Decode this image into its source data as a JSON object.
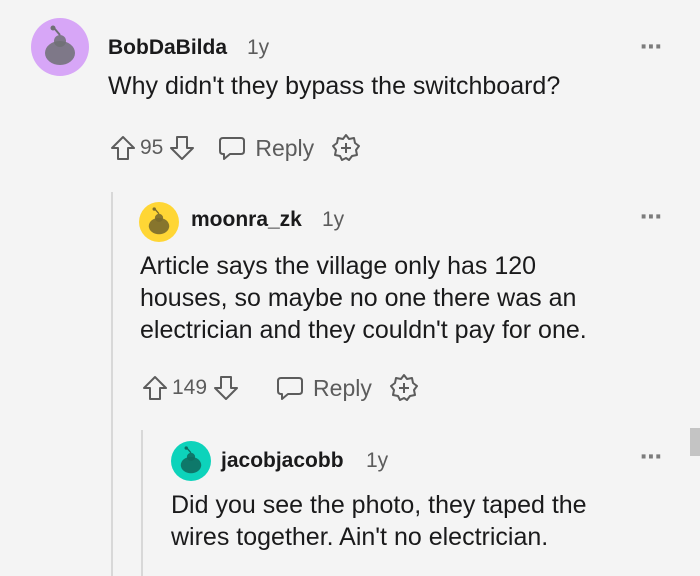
{
  "comments": [
    {
      "username": "BobDaBilda",
      "age": "1y",
      "body": "Why didn't they bypass the switchboard?",
      "votes": "95",
      "reply_label": "Reply",
      "avatar_color": "#d7a6f7"
    },
    {
      "username": "moonra_zk",
      "age": "1y",
      "body_lines": [
        "Article says the village only has 120",
        "houses, so maybe no one there was an",
        "electrician and they couldn't pay for one."
      ],
      "votes": "149",
      "reply_label": "Reply",
      "avatar_color": "#ffd635"
    },
    {
      "username": "jacobjacobb",
      "age": "1y",
      "body_lines": [
        "Did you see the photo, they taped the",
        "wires together. Ain't no electrician."
      ],
      "avatar_color": "#0dd3bb"
    }
  ],
  "more_icon": "⋯",
  "colors": {
    "text": "#1a1a1b",
    "meta": "#5c5c5c",
    "background": "#f4f4f4"
  }
}
